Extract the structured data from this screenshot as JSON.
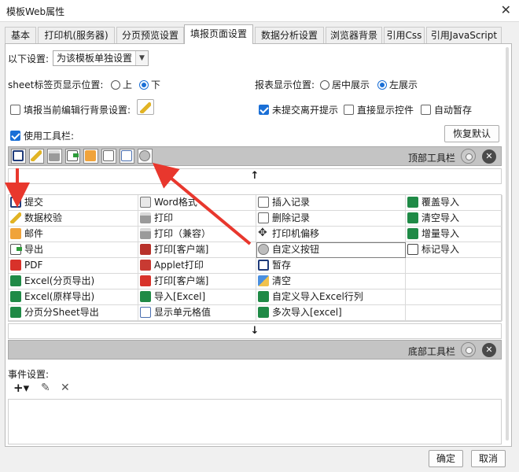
{
  "window": {
    "title": "模板Web属性",
    "close_glyph": "✕"
  },
  "tabs": [
    {
      "label": "基本",
      "active": false
    },
    {
      "label": "打印机(服务器)",
      "active": false
    },
    {
      "label": "分页预览设置",
      "active": false
    },
    {
      "label": "填报页面设置",
      "active": true
    },
    {
      "label": "数据分析设置",
      "active": false
    },
    {
      "label": "浏览器背景",
      "active": false
    },
    {
      "label": "引用Css",
      "active": false
    },
    {
      "label": "引用JavaScript",
      "active": false
    }
  ],
  "settings": {
    "scope_label": "以下设置:",
    "scope_value": "为该模板单独设置",
    "sheet_tab_label": "sheet标签页显示位置:",
    "sheet_tab_options": [
      {
        "label": "上",
        "selected": false
      },
      {
        "label": "下",
        "selected": true
      }
    ],
    "report_pos_label": "报表显示位置:",
    "report_pos_options": [
      {
        "label": "居中展示",
        "selected": false
      },
      {
        "label": "左展示",
        "selected": true
      }
    ],
    "fill_bg_label": "填报当前编辑行背景设置:",
    "fill_bg_checked": false,
    "unsubmitted_label": "未提交离开提示",
    "unsubmitted_checked": true,
    "direct_widget_label": "直接显示控件",
    "direct_widget_checked": false,
    "autosave_label": "自动暂存",
    "autosave_checked": false,
    "use_toolbar_label": "使用工具栏:",
    "use_toolbar_checked": true,
    "restore_default": "恢复默认"
  },
  "top_toolbar": {
    "label": "顶部工具栏",
    "icons": [
      "save-icon",
      "edit-icon",
      "print-icon",
      "export-icon",
      "mail-icon",
      "tree-icon",
      "window-icon",
      "gear-icon"
    ]
  },
  "bottom_toolbar": {
    "label": "底部工具栏"
  },
  "arrows": {
    "up": "↑",
    "down": "↓"
  },
  "button_grid": {
    "columns": [
      [
        {
          "label": "提交",
          "icon": "save"
        },
        {
          "label": "数据校验",
          "icon": "edit"
        },
        {
          "label": "邮件",
          "icon": "mail"
        },
        {
          "label": "导出",
          "icon": "export"
        },
        {
          "label": "PDF",
          "icon": "pdf"
        },
        {
          "label": "Excel(分页导出)",
          "icon": "excel"
        },
        {
          "label": "Excel(原样导出)",
          "icon": "excel"
        },
        {
          "label": "分页分Sheet导出",
          "icon": "excel"
        }
      ],
      [
        {
          "label": "Word格式",
          "icon": "word"
        },
        {
          "label": "打印",
          "icon": "print"
        },
        {
          "label": "打印（兼容）",
          "icon": "print"
        },
        {
          "label": "打印[客户端]",
          "icon": "red"
        },
        {
          "label": "Applet打印",
          "icon": "applet"
        },
        {
          "label": "打印[客户端]",
          "icon": "pdf"
        },
        {
          "label": "导入[Excel]",
          "icon": "excel"
        },
        {
          "label": "显示单元格值",
          "icon": "plain"
        }
      ],
      [
        {
          "label": "插入记录",
          "icon": "insert"
        },
        {
          "label": "删除记录",
          "icon": "insert"
        },
        {
          "label": "打印机偏移",
          "icon": "move"
        },
        {
          "label": "自定义按钮",
          "icon": "gear",
          "selected": true
        },
        {
          "label": "暂存",
          "icon": "save"
        },
        {
          "label": "清空",
          "icon": "clear"
        },
        {
          "label": "自定义导入Excel行列",
          "icon": "excel"
        },
        {
          "label": "多次导入[excel]",
          "icon": "excel"
        }
      ],
      [
        {
          "label": "覆盖导入",
          "icon": "excel"
        },
        {
          "label": "清空导入",
          "icon": "excel"
        },
        {
          "label": "增量导入",
          "icon": "excel"
        },
        {
          "label": "标记导入",
          "icon": "mark"
        },
        {
          "label": "",
          "icon": ""
        },
        {
          "label": "",
          "icon": ""
        },
        {
          "label": "",
          "icon": ""
        },
        {
          "label": "",
          "icon": ""
        }
      ]
    ]
  },
  "events": {
    "label": "事件设置:",
    "add_glyph": "+▾",
    "edit_glyph": "✎",
    "delete_glyph": "✕"
  },
  "footer": {
    "ok": "确定",
    "cancel": "取消"
  },
  "colors": {
    "accent": "#1a6fd6",
    "annotation_arrow": "#e8372d",
    "toolbar_bg": "#c4c4c4"
  }
}
